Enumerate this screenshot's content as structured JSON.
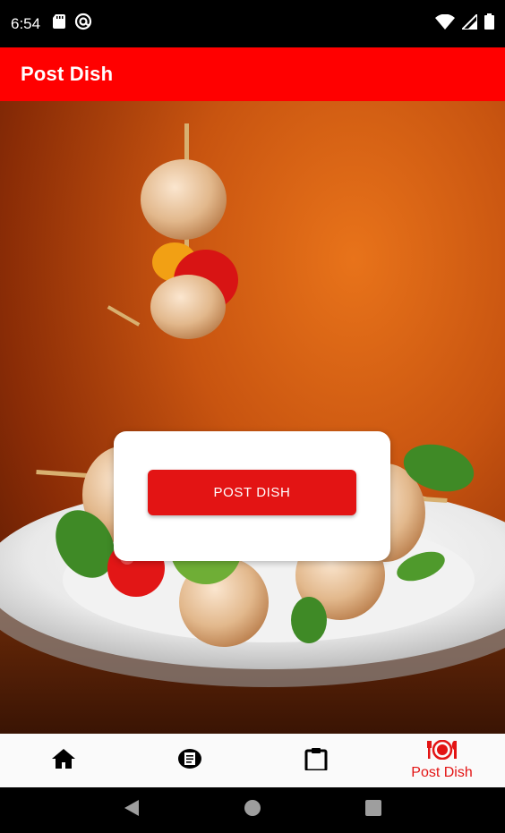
{
  "status_bar": {
    "time": "6:54",
    "left_icons": [
      "sd-card-icon",
      "at-sign-icon"
    ],
    "right_icons": [
      "wifi-icon",
      "signal-icon",
      "battery-icon"
    ]
  },
  "app_bar": {
    "title": "Post Dish",
    "color": "#ff0000"
  },
  "hero": {
    "image": "grilled-chicken-skewers-photo"
  },
  "card": {
    "button_label": "POST DISH",
    "button_color": "#e31414"
  },
  "bottom_nav": {
    "items": [
      {
        "icon": "home-icon",
        "label": ""
      },
      {
        "icon": "receipt-icon",
        "label": ""
      },
      {
        "icon": "clipboard-icon",
        "label": ""
      },
      {
        "icon": "dining-icon",
        "label": "Post Dish",
        "active": true
      }
    ],
    "active_color": "#e31414"
  },
  "system_nav": {
    "buttons": [
      "back-icon",
      "home-circle-icon",
      "recents-icon"
    ]
  }
}
